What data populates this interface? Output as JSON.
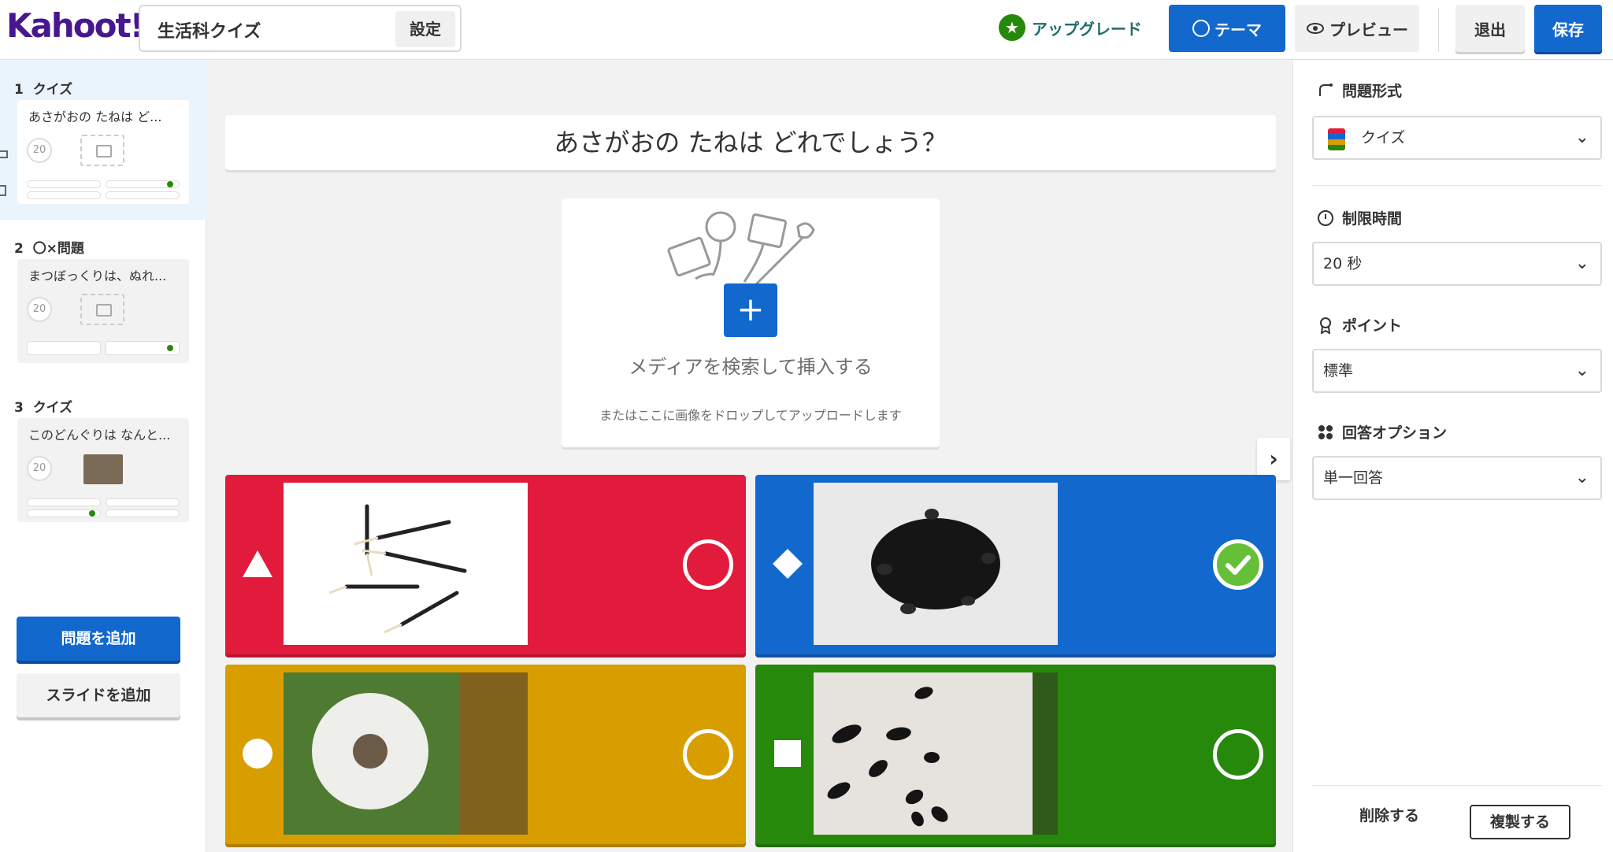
{
  "header": {
    "logo": "Kahoot!",
    "quiz_title": "生活科クイズ",
    "settings_label": "設定",
    "upgrade_label": "アップグレード",
    "theme_label": "テーマ",
    "preview_label": "プレビュー",
    "exit_label": "退出",
    "save_label": "保存"
  },
  "sidebar": {
    "questions": [
      {
        "number": "1",
        "type": "クイズ",
        "text": "あさがおの たねは ど...",
        "time": "20"
      },
      {
        "number": "2",
        "type": "〇×問題",
        "text": "まつぼっくりは、ぬれ...",
        "time": "20"
      },
      {
        "number": "3",
        "type": "クイズ",
        "text": "このどんぐりは なんと...",
        "time": "20"
      }
    ],
    "add_question_label": "問題を追加",
    "add_slide_label": "スライドを追加"
  },
  "editor": {
    "question_text": "あさがおの たねは どれでしょう？",
    "media_label": "メディアを検索して挿入する",
    "media_sub": "またはここに画像をドロップしてアップロードします",
    "answers": [
      {
        "color": "red",
        "shape": "triangle",
        "image": "dandelion-seeds-white",
        "correct": false
      },
      {
        "color": "blue",
        "shape": "diamond",
        "image": "morning-glory-seeds",
        "correct": true
      },
      {
        "color": "yellow",
        "shape": "circle",
        "image": "dandelion-puff",
        "correct": false
      },
      {
        "color": "green",
        "shape": "square",
        "image": "sunflower-seeds",
        "correct": false
      }
    ]
  },
  "rpanel": {
    "question_type_title": "問題形式",
    "question_type_value": "クイズ",
    "time_limit_title": "制限時間",
    "time_limit_value": "20 秒",
    "points_title": "ポイント",
    "points_value": "標準",
    "answer_options_title": "回答オプション",
    "answer_options_value": "単一回答",
    "delete_label": "削除する",
    "duplicate_label": "複製する"
  },
  "colors": {
    "red": "#e21b3c",
    "blue": "#1368ce",
    "yellow": "#d89e00",
    "green": "#26890c",
    "brand": "#46178f"
  }
}
